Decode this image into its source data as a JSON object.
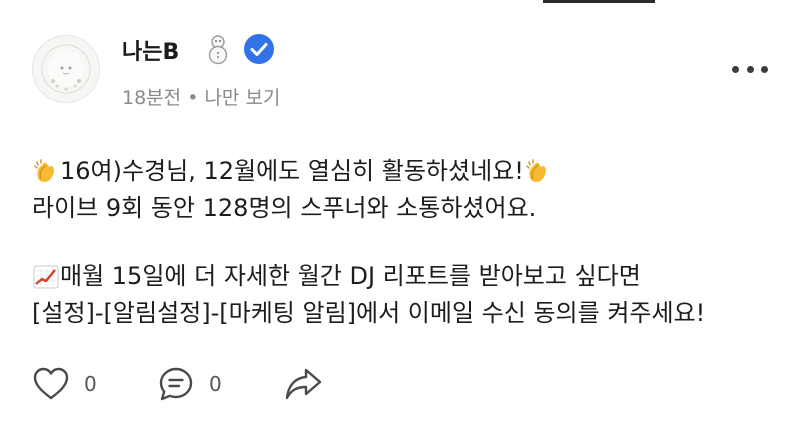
{
  "author": {
    "name": "나는B",
    "status_emoji": "snowman-icon",
    "verified_badge": "verified-check-icon"
  },
  "meta": {
    "time": "18분전",
    "separator": "•",
    "visibility": "나만 보기"
  },
  "post": {
    "line1_text": "16여)수경님, 12월에도 열심히 활동하셨네요!",
    "line2_text": "라이브 9회 동안 128명의 스푸너와 소통하셨어요.",
    "line3_text": "매월 15일에 더 자세한 월간 DJ 리포트를 받아보고 싶다면",
    "line4_text": "[설정]-[알림설정]-[마케팅 알림]에서 이메일 수신 동의를 켜주세요!",
    "icons": [
      "clapping-hands-icon",
      "clapping-hands-icon",
      "chart-increasing-icon"
    ]
  },
  "actions": {
    "like_count": "0",
    "comment_count": "0"
  },
  "colors": {
    "verified_blue": "#2f73e6",
    "text": "#1d1d1d",
    "meta": "#8a8a8a",
    "clap_yellow": "#f6b931",
    "chart_red": "#d9402b"
  }
}
